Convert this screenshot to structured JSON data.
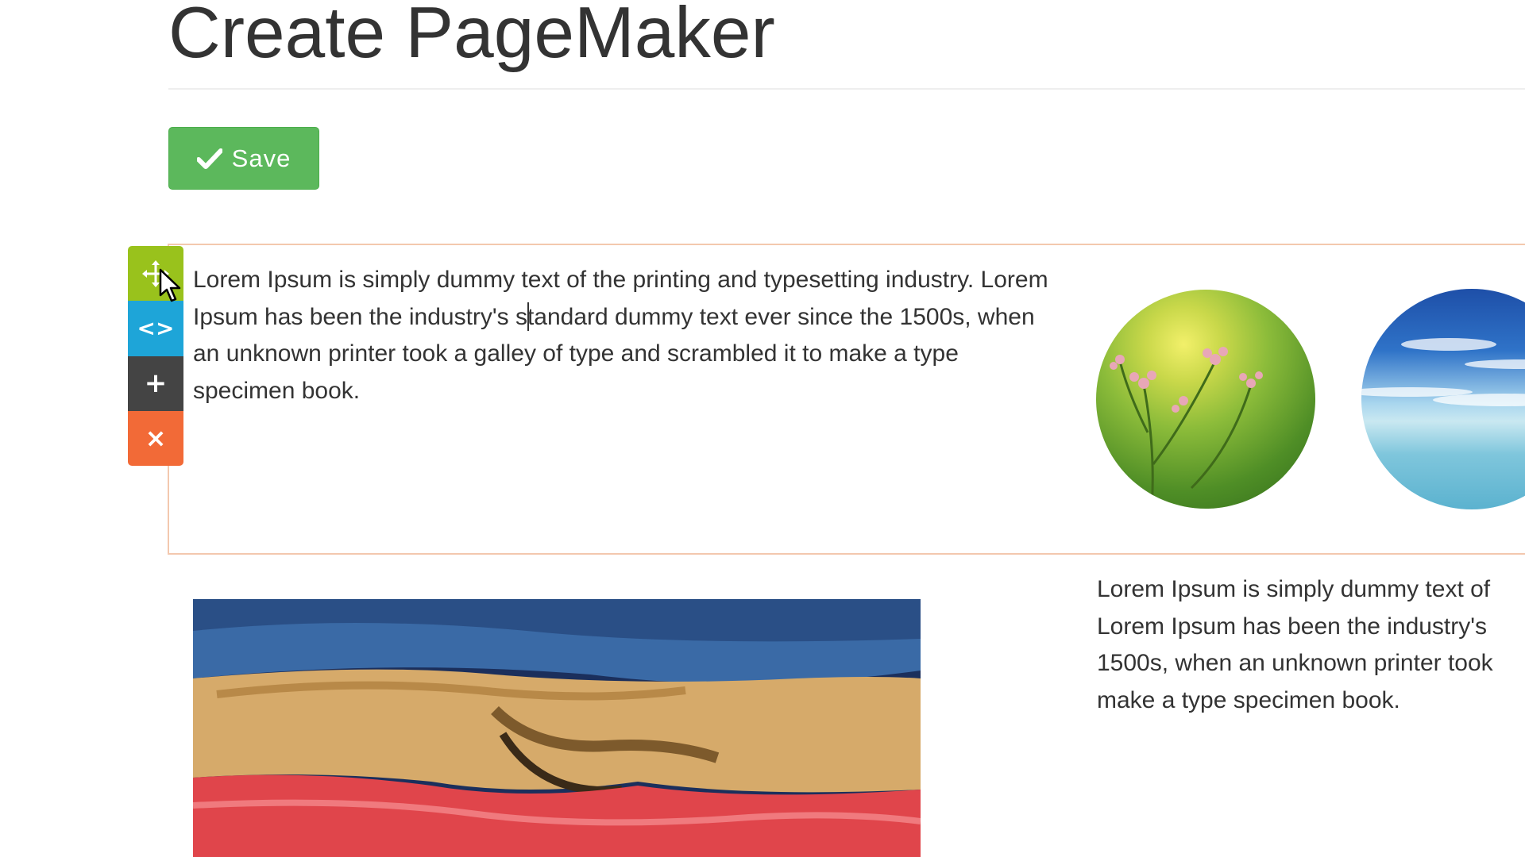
{
  "page": {
    "title": "Create PageMaker"
  },
  "toolbar": {
    "save_label": "Save"
  },
  "row_tools": [
    {
      "name": "move",
      "icon": "move-arrows-icon",
      "color": "#99c21c"
    },
    {
      "name": "code",
      "icon": "code-brackets-icon",
      "glyph": "<>",
      "color": "#1ea5d8"
    },
    {
      "name": "add",
      "icon": "plus-icon",
      "glyph": "+",
      "color": "#444444"
    },
    {
      "name": "delete",
      "icon": "close-icon",
      "glyph": "×",
      "color": "#f26a37"
    }
  ],
  "content": {
    "main_paragraph": "Lorem Ipsum is simply dummy text of the printing and typesetting industry. Lorem Ipsum has been the industry's standard dummy text ever since the 1500s, when an unknown printer took a galley of type and scrambled it to make a type specimen book.",
    "side_paragraph_lines": [
      "Lorem Ipsum is simply dummy text of",
      "Lorem Ipsum has been the industry's",
      "1500s, when an unknown printer took",
      "make a type specimen book."
    ]
  },
  "colors": {
    "save_green": "#5cb85c",
    "row_border": "#f3c8ae",
    "text": "#333333"
  }
}
